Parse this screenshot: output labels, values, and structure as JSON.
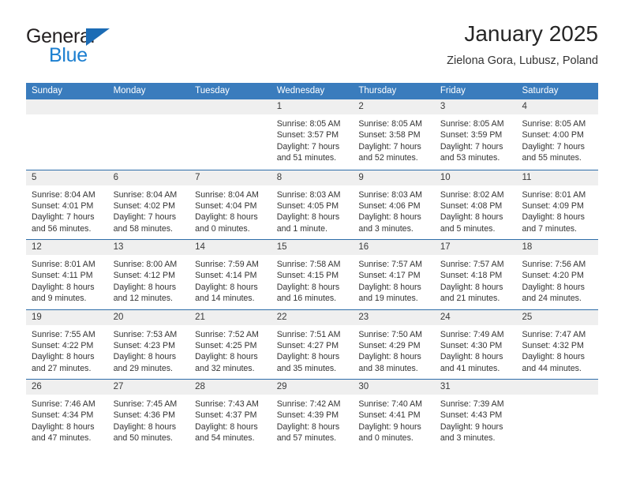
{
  "brand": {
    "name_top": "General",
    "name_bottom": "Blue",
    "triangle_color": "#1c6cb5",
    "blue_color": "#1c7fd0"
  },
  "header": {
    "title": "January 2025",
    "subtitle": "Zielona Gora, Lubusz, Poland"
  },
  "theme": {
    "header_band": "#3a7cbd",
    "row_rule": "#2e6da9",
    "day_band": "#efefef"
  },
  "weekdays": [
    "Sunday",
    "Monday",
    "Tuesday",
    "Wednesday",
    "Thursday",
    "Friday",
    "Saturday"
  ],
  "weeks": [
    [
      {
        "day": "",
        "lines": []
      },
      {
        "day": "",
        "lines": []
      },
      {
        "day": "",
        "lines": []
      },
      {
        "day": "1",
        "lines": [
          "Sunrise: 8:05 AM",
          "Sunset: 3:57 PM",
          "Daylight: 7 hours",
          "and 51 minutes."
        ]
      },
      {
        "day": "2",
        "lines": [
          "Sunrise: 8:05 AM",
          "Sunset: 3:58 PM",
          "Daylight: 7 hours",
          "and 52 minutes."
        ]
      },
      {
        "day": "3",
        "lines": [
          "Sunrise: 8:05 AM",
          "Sunset: 3:59 PM",
          "Daylight: 7 hours",
          "and 53 minutes."
        ]
      },
      {
        "day": "4",
        "lines": [
          "Sunrise: 8:05 AM",
          "Sunset: 4:00 PM",
          "Daylight: 7 hours",
          "and 55 minutes."
        ]
      }
    ],
    [
      {
        "day": "5",
        "lines": [
          "Sunrise: 8:04 AM",
          "Sunset: 4:01 PM",
          "Daylight: 7 hours",
          "and 56 minutes."
        ]
      },
      {
        "day": "6",
        "lines": [
          "Sunrise: 8:04 AM",
          "Sunset: 4:02 PM",
          "Daylight: 7 hours",
          "and 58 minutes."
        ]
      },
      {
        "day": "7",
        "lines": [
          "Sunrise: 8:04 AM",
          "Sunset: 4:04 PM",
          "Daylight: 8 hours",
          "and 0 minutes."
        ]
      },
      {
        "day": "8",
        "lines": [
          "Sunrise: 8:03 AM",
          "Sunset: 4:05 PM",
          "Daylight: 8 hours",
          "and 1 minute."
        ]
      },
      {
        "day": "9",
        "lines": [
          "Sunrise: 8:03 AM",
          "Sunset: 4:06 PM",
          "Daylight: 8 hours",
          "and 3 minutes."
        ]
      },
      {
        "day": "10",
        "lines": [
          "Sunrise: 8:02 AM",
          "Sunset: 4:08 PM",
          "Daylight: 8 hours",
          "and 5 minutes."
        ]
      },
      {
        "day": "11",
        "lines": [
          "Sunrise: 8:01 AM",
          "Sunset: 4:09 PM",
          "Daylight: 8 hours",
          "and 7 minutes."
        ]
      }
    ],
    [
      {
        "day": "12",
        "lines": [
          "Sunrise: 8:01 AM",
          "Sunset: 4:11 PM",
          "Daylight: 8 hours",
          "and 9 minutes."
        ]
      },
      {
        "day": "13",
        "lines": [
          "Sunrise: 8:00 AM",
          "Sunset: 4:12 PM",
          "Daylight: 8 hours",
          "and 12 minutes."
        ]
      },
      {
        "day": "14",
        "lines": [
          "Sunrise: 7:59 AM",
          "Sunset: 4:14 PM",
          "Daylight: 8 hours",
          "and 14 minutes."
        ]
      },
      {
        "day": "15",
        "lines": [
          "Sunrise: 7:58 AM",
          "Sunset: 4:15 PM",
          "Daylight: 8 hours",
          "and 16 minutes."
        ]
      },
      {
        "day": "16",
        "lines": [
          "Sunrise: 7:57 AM",
          "Sunset: 4:17 PM",
          "Daylight: 8 hours",
          "and 19 minutes."
        ]
      },
      {
        "day": "17",
        "lines": [
          "Sunrise: 7:57 AM",
          "Sunset: 4:18 PM",
          "Daylight: 8 hours",
          "and 21 minutes."
        ]
      },
      {
        "day": "18",
        "lines": [
          "Sunrise: 7:56 AM",
          "Sunset: 4:20 PM",
          "Daylight: 8 hours",
          "and 24 minutes."
        ]
      }
    ],
    [
      {
        "day": "19",
        "lines": [
          "Sunrise: 7:55 AM",
          "Sunset: 4:22 PM",
          "Daylight: 8 hours",
          "and 27 minutes."
        ]
      },
      {
        "day": "20",
        "lines": [
          "Sunrise: 7:53 AM",
          "Sunset: 4:23 PM",
          "Daylight: 8 hours",
          "and 29 minutes."
        ]
      },
      {
        "day": "21",
        "lines": [
          "Sunrise: 7:52 AM",
          "Sunset: 4:25 PM",
          "Daylight: 8 hours",
          "and 32 minutes."
        ]
      },
      {
        "day": "22",
        "lines": [
          "Sunrise: 7:51 AM",
          "Sunset: 4:27 PM",
          "Daylight: 8 hours",
          "and 35 minutes."
        ]
      },
      {
        "day": "23",
        "lines": [
          "Sunrise: 7:50 AM",
          "Sunset: 4:29 PM",
          "Daylight: 8 hours",
          "and 38 minutes."
        ]
      },
      {
        "day": "24",
        "lines": [
          "Sunrise: 7:49 AM",
          "Sunset: 4:30 PM",
          "Daylight: 8 hours",
          "and 41 minutes."
        ]
      },
      {
        "day": "25",
        "lines": [
          "Sunrise: 7:47 AM",
          "Sunset: 4:32 PM",
          "Daylight: 8 hours",
          "and 44 minutes."
        ]
      }
    ],
    [
      {
        "day": "26",
        "lines": [
          "Sunrise: 7:46 AM",
          "Sunset: 4:34 PM",
          "Daylight: 8 hours",
          "and 47 minutes."
        ]
      },
      {
        "day": "27",
        "lines": [
          "Sunrise: 7:45 AM",
          "Sunset: 4:36 PM",
          "Daylight: 8 hours",
          "and 50 minutes."
        ]
      },
      {
        "day": "28",
        "lines": [
          "Sunrise: 7:43 AM",
          "Sunset: 4:37 PM",
          "Daylight: 8 hours",
          "and 54 minutes."
        ]
      },
      {
        "day": "29",
        "lines": [
          "Sunrise: 7:42 AM",
          "Sunset: 4:39 PM",
          "Daylight: 8 hours",
          "and 57 minutes."
        ]
      },
      {
        "day": "30",
        "lines": [
          "Sunrise: 7:40 AM",
          "Sunset: 4:41 PM",
          "Daylight: 9 hours",
          "and 0 minutes."
        ]
      },
      {
        "day": "31",
        "lines": [
          "Sunrise: 7:39 AM",
          "Sunset: 4:43 PM",
          "Daylight: 9 hours",
          "and 3 minutes."
        ]
      },
      {
        "day": "",
        "lines": []
      }
    ]
  ]
}
